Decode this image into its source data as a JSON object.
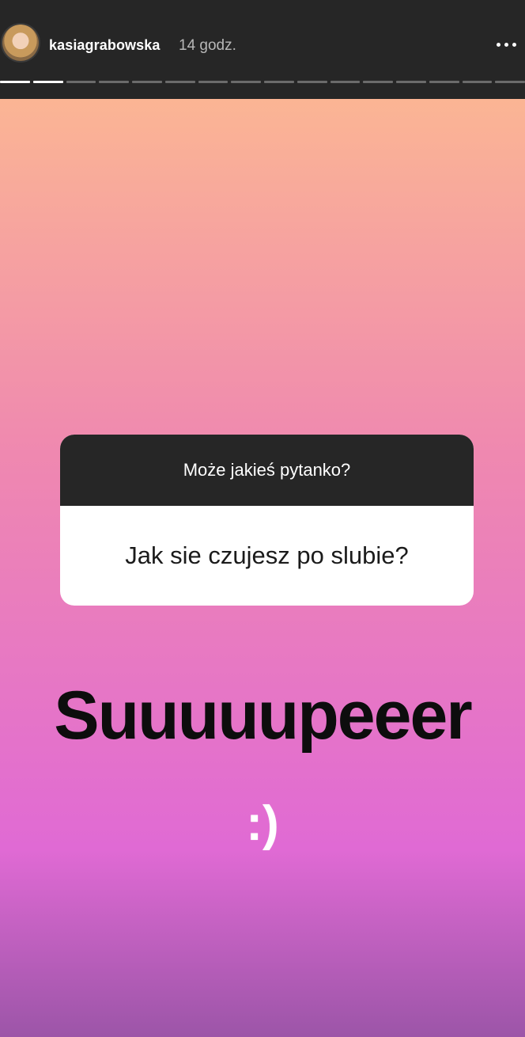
{
  "header": {
    "username": "kasiagrabowska",
    "time": "14 godz.",
    "avatar_icon": "user-avatar",
    "more_icon": "more-horizontal-icon",
    "progress_segments": 16,
    "progress_current_index": 1
  },
  "story": {
    "question_prompt": "Może jakieś pytanko?",
    "question_text": "Jak sie czujesz po slubie?",
    "answer_text": "Suuuuupeeer",
    "smiley_text": ":)",
    "gradient_colors": [
      "#fbb594",
      "#ef88b0",
      "#e06ad4",
      "#9c55a8"
    ]
  }
}
